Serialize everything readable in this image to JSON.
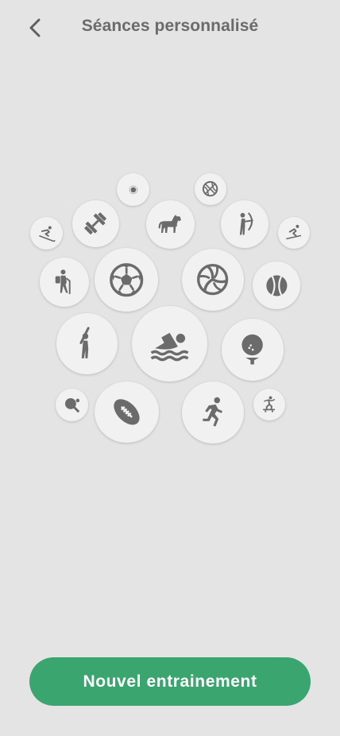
{
  "header": {
    "title": "Séances personnalisé",
    "back_icon": "chevron-left-icon"
  },
  "sports": [
    {
      "id": "skiing",
      "icon": "skiing-icon"
    },
    {
      "id": "dumbbell",
      "icon": "dumbbell-icon"
    },
    {
      "id": "small-dot",
      "icon": "small-dot-icon"
    },
    {
      "id": "horse",
      "icon": "horse-icon"
    },
    {
      "id": "basketball",
      "icon": "basketball-icon"
    },
    {
      "id": "archery",
      "icon": "archery-icon"
    },
    {
      "id": "skiing-2",
      "icon": "skiing-icon"
    },
    {
      "id": "hiking",
      "icon": "hiking-icon"
    },
    {
      "id": "soccer",
      "icon": "soccer-ball-icon"
    },
    {
      "id": "volleyball",
      "icon": "volleyball-icon"
    },
    {
      "id": "tennis",
      "icon": "tennis-ball-icon"
    },
    {
      "id": "baseball",
      "icon": "baseball-batter-icon"
    },
    {
      "id": "swimming",
      "icon": "swimmer-icon"
    },
    {
      "id": "golf",
      "icon": "golf-ball-tee-icon"
    },
    {
      "id": "ping-pong",
      "icon": "ping-pong-icon"
    },
    {
      "id": "rugby",
      "icon": "rugby-ball-icon"
    },
    {
      "id": "running",
      "icon": "runner-icon"
    },
    {
      "id": "skateboard",
      "icon": "skateboarder-icon"
    }
  ],
  "colors": {
    "background": "#e4e4e4",
    "bubble": "#f1f1f1",
    "icon": "#6b6b6b",
    "accent": "#3aa56f",
    "button_text": "#ffffff"
  },
  "cta": {
    "label": "Nouvel entrainement"
  }
}
